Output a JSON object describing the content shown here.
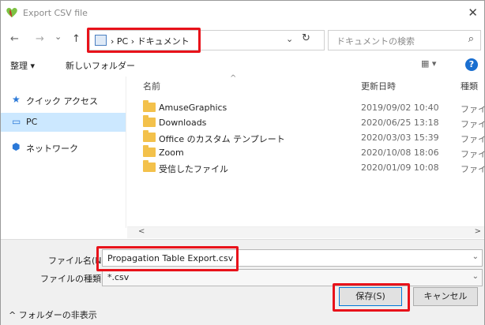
{
  "window": {
    "title": "Export CSV file",
    "close_glyph": "✕"
  },
  "nav": {
    "back": "←",
    "forward": "→",
    "recent": "⌄",
    "up": "↑",
    "breadcrumb": [
      "PC",
      "ドキュメント"
    ],
    "separator": "›",
    "address_dropdown": "⌄",
    "refresh": "↻",
    "search_placeholder": "ドキュメントの検索",
    "search_glyph": "⌕"
  },
  "commands": {
    "organize": "整理 ▾",
    "new_folder": "新しいフォルダー",
    "view": "▦ ▾",
    "help": "?"
  },
  "sidebar": {
    "items": [
      {
        "label": "クイック アクセス",
        "icon": "★"
      },
      {
        "label": "PC",
        "icon": "▭",
        "selected": true
      },
      {
        "label": "ネットワーク",
        "icon": "⬢"
      }
    ]
  },
  "columns": {
    "name": "名前",
    "modified": "更新日時",
    "type": "種類",
    "sort_caret": "^"
  },
  "files": [
    {
      "name": "AmuseGraphics",
      "modified": "2019/09/02 10:40",
      "type": "ファイル"
    },
    {
      "name": "Downloads",
      "modified": "2020/06/25 13:18",
      "type": "ファイル"
    },
    {
      "name": "Office のカスタム テンプレート",
      "modified": "2020/03/03 15:39",
      "type": "ファイル"
    },
    {
      "name": "Zoom",
      "modified": "2020/10/08 18:06",
      "type": "ファイル"
    },
    {
      "name": "受信したファイル",
      "modified": "2020/01/09 10:08",
      "type": "ファイル"
    }
  ],
  "scroll": {
    "left": "<",
    "right": ">"
  },
  "form": {
    "filename_label": "ファイル名(N):",
    "filename_value": "Propagation Table Export.csv",
    "filetype_label": "ファイルの種類(T):",
    "filetype_value": "*.csv",
    "dropdown_glyph": "⌄"
  },
  "footer": {
    "hide_folders": "^ フォルダーの非表示",
    "save": "保存(S)",
    "cancel": "キャンセル"
  },
  "colors": {
    "highlight": "#e8121a",
    "selection": "#cce8ff",
    "folder": "#f3c14b"
  }
}
